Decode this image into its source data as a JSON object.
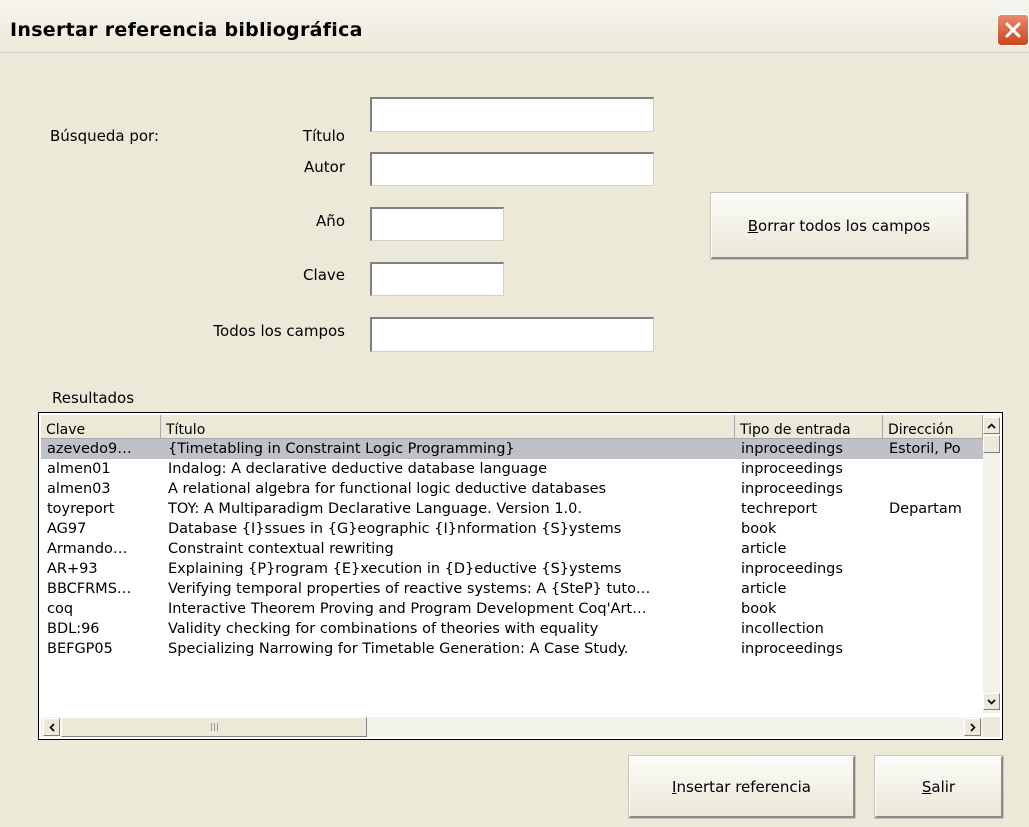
{
  "window": {
    "title": "Insertar referencia bibliográfica"
  },
  "search": {
    "label": "Búsqueda por:",
    "fields": {
      "titulo": {
        "label": "Título",
        "value": ""
      },
      "autor": {
        "label": "Autor",
        "value": ""
      },
      "anio": {
        "label": "Año",
        "value": ""
      },
      "clave": {
        "label": "Clave",
        "value": ""
      },
      "todos": {
        "label": "Todos los campos",
        "value": ""
      }
    },
    "clear_button": {
      "mnemonic": "B",
      "rest": "orrar todos los campos"
    }
  },
  "results": {
    "label": "Resultados",
    "columns": [
      "Clave",
      "Título",
      "Tipo de entrada",
      "Dirección"
    ],
    "selected_row": 0,
    "rows": [
      [
        "azevedo9…",
        "{Timetabling in Constraint Logic Programming}",
        "inproceedings",
        "Estoril, Po"
      ],
      [
        "almen01",
        "Indalog: A declarative deductive database language",
        "inproceedings",
        ""
      ],
      [
        "almen03",
        "A relational algebra for functional logic deductive databases",
        "inproceedings",
        ""
      ],
      [
        "toyreport",
        "TOY: A Multiparadigm Declarative Language. Version 1.0.",
        "techreport",
        "Departam"
      ],
      [
        "AG97",
        "Database {I}ssues in {G}eographic {I}nformation {S}ystems",
        "book",
        ""
      ],
      [
        "Armando…",
        "Constraint contextual rewriting",
        "article",
        ""
      ],
      [
        "AR+93",
        "Explaining {P}rogram {E}xecution in {D}eductive {S}ystems",
        "inproceedings",
        ""
      ],
      [
        "BBCFRMS…",
        "Verifying temporal properties of reactive systems: A {SteP} tuto…",
        "article",
        ""
      ],
      [
        "coq",
        "Interactive Theorem Proving and Program Development Coq'Art…",
        "book",
        ""
      ],
      [
        "BDL:96",
        "Validity checking for combinations of theories with equality",
        "incollection",
        ""
      ],
      [
        "BEFGP05",
        "Specializing Narrowing for Timetable Generation: A Case Study.",
        "inproceedings",
        ""
      ]
    ]
  },
  "buttons": {
    "insert": {
      "mnemonic": "I",
      "rest": "nsertar referencia"
    },
    "exit": {
      "mnemonic": "S",
      "rest": "alir"
    }
  }
}
